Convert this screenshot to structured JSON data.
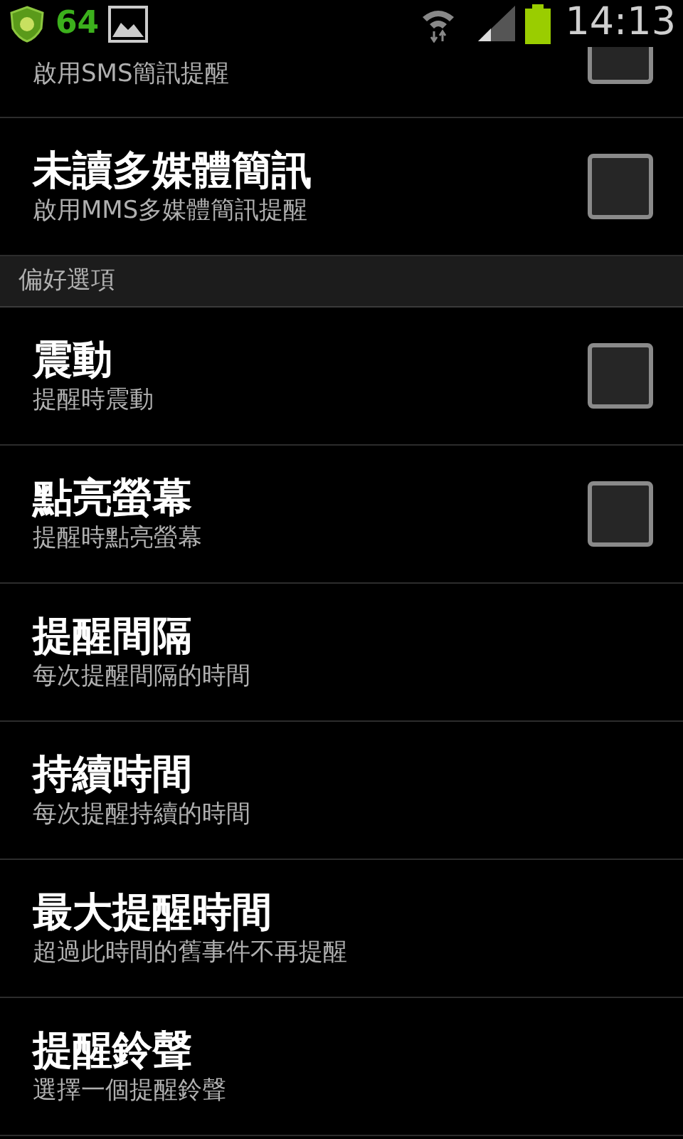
{
  "status_bar": {
    "badge_count": "64",
    "time": "14:13"
  },
  "items": [
    {
      "kind": "partial",
      "subtitle": "啟用SMS簡訊提醒",
      "checked": false
    },
    {
      "kind": "checkbox",
      "title": "未讀多媒體簡訊",
      "subtitle": "啟用MMS多媒體簡訊提醒",
      "checked": false
    },
    {
      "kind": "header",
      "title": "偏好選項"
    },
    {
      "kind": "checkbox",
      "title": "震動",
      "subtitle": "提醒時震動",
      "checked": false
    },
    {
      "kind": "checkbox",
      "title": "點亮螢幕",
      "subtitle": "提醒時點亮螢幕",
      "checked": false
    },
    {
      "kind": "plain",
      "title": "提醒間隔",
      "subtitle": "每次提醒間隔的時間"
    },
    {
      "kind": "plain",
      "title": "持續時間",
      "subtitle": "每次提醒持續的時間"
    },
    {
      "kind": "plain",
      "title": "最大提醒時間",
      "subtitle": "超過此時間的舊事件不再提醒"
    },
    {
      "kind": "plain",
      "title": "提醒鈴聲",
      "subtitle": "選擇一個提醒鈴聲"
    }
  ]
}
